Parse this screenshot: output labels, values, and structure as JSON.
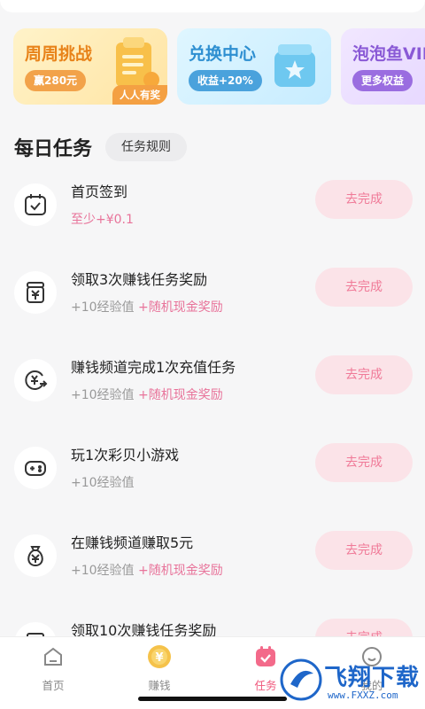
{
  "promo_cards": [
    {
      "title": "周周挑战",
      "pill": "赢280元",
      "corner": "人人有奖"
    },
    {
      "title": "兑换中心",
      "pill": "收益+20%"
    },
    {
      "title": "泡泡鱼VIP",
      "pill": "更多权益"
    }
  ],
  "section": {
    "title": "每日任务",
    "rules_label": "任务规则"
  },
  "tasks": [
    {
      "name": "首页签到",
      "reward": "至少+¥0.1",
      "button": "去完成",
      "icon": "calendar-check-icon"
    },
    {
      "name": "领取3次赚钱任务奖励",
      "exp": "+10经验值",
      "bonus": "+随机现金奖励",
      "button": "去完成",
      "icon": "yuan-box-icon"
    },
    {
      "name": "赚钱频道完成1次充值任务",
      "exp": "+10经验值",
      "bonus": "+随机现金奖励",
      "button": "去完成",
      "icon": "yuan-exchange-icon"
    },
    {
      "name": "玩1次彩贝小游戏",
      "exp": "+10经验值",
      "button": "去完成",
      "icon": "gamepad-icon"
    },
    {
      "name": "在赚钱频道赚取5元",
      "exp": "+10经验值",
      "bonus": "+随机现金奖励",
      "button": "去完成",
      "icon": "money-bag-icon"
    },
    {
      "name": "领取10次赚钱任务奖励",
      "button": "去完成",
      "icon": "yuan-box-icon"
    }
  ],
  "nav": {
    "items": [
      {
        "label": "首页",
        "icon": "home-icon"
      },
      {
        "label": "赚钱",
        "icon": "coin-icon"
      },
      {
        "label": "任务",
        "icon": "task-calendar-icon",
        "active": true
      },
      {
        "label": "我的",
        "icon": "profile-icon"
      }
    ]
  },
  "watermark": {
    "text": "飞翔下载",
    "url": "www.FXXZ.com"
  },
  "colors": {
    "accent": "#f05a7e",
    "button_bg": "#fbe3e8",
    "button_text": "#f07a98",
    "highlight": "#e8739a"
  }
}
